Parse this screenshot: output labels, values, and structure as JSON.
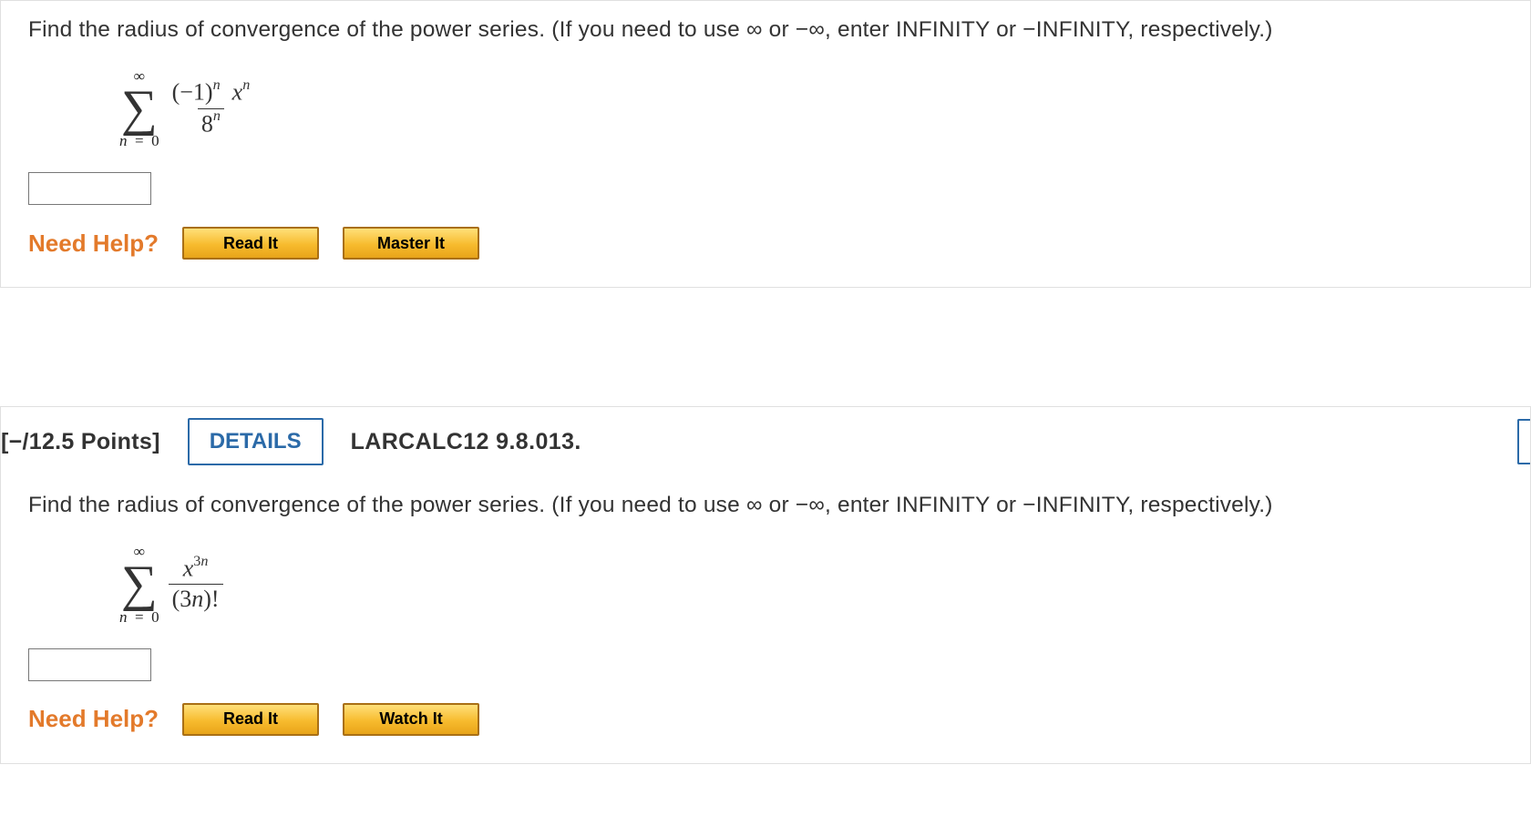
{
  "q1": {
    "prompt": "Find the radius of convergence of the power series. (If you need to use ∞ or −∞, enter INFINITY or −INFINITY, respectively.)",
    "formula": {
      "upper_limit": "∞",
      "lower_limit_var": "n",
      "lower_limit_eq": "=",
      "lower_limit_val": "0",
      "num_base1": "(−1)",
      "num_exp1": "n",
      "num_base2": "x",
      "num_exp2": "n",
      "den_base": "8",
      "den_exp": "n"
    },
    "need_help": "Need Help?",
    "buttons": {
      "read": "Read It",
      "master": "Master It"
    }
  },
  "header2": {
    "points": "[−/12.5 Points]",
    "details": "DETAILS",
    "ref": "LARCALC12 9.8.013."
  },
  "q2": {
    "prompt": "Find the radius of convergence of the power series. (If you need to use ∞ or −∞, enter INFINITY or −INFINITY, respectively.)",
    "formula": {
      "upper_limit": "∞",
      "lower_limit_var": "n",
      "lower_limit_eq": "=",
      "lower_limit_val": "0",
      "num_base": "x",
      "num_exp_a": "3",
      "num_exp_b": "n",
      "den_a": "(3",
      "den_b": "n",
      "den_c": ")!"
    },
    "need_help": "Need Help?",
    "buttons": {
      "read": "Read It",
      "watch": "Watch It"
    }
  }
}
